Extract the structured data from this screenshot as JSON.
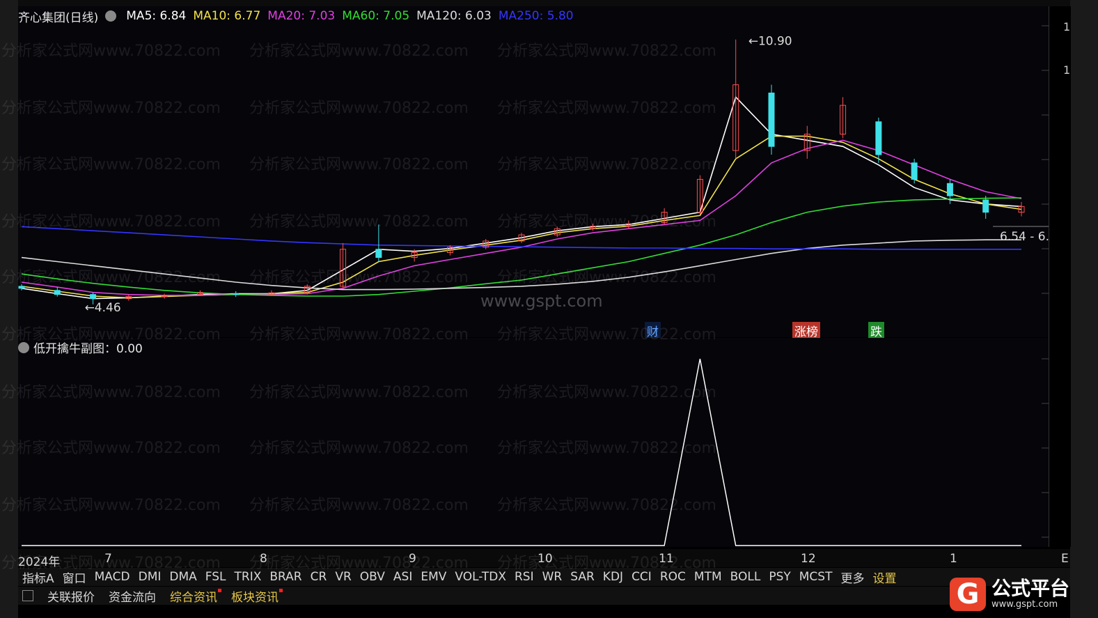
{
  "title": "齐心集团(日线)",
  "ma": [
    {
      "label": "MA5: 6.84",
      "color": "#ffffff"
    },
    {
      "label": "MA10: 6.77",
      "color": "#f2e24a"
    },
    {
      "label": "MA20: 7.03",
      "color": "#e040e0"
    },
    {
      "label": "MA60: 7.05",
      "color": "#33dd33"
    },
    {
      "label": "MA120: 6.03",
      "color": "#dddddd"
    },
    {
      "label": "MA250: 5.80",
      "color": "#3535ff"
    }
  ],
  "annotations": {
    "high": "10.90",
    "low": "4.46",
    "right": "6.54 - 6."
  },
  "tags": {
    "cai": "财",
    "zhangbang": "涨榜",
    "die": "跌"
  },
  "sub_title": "低开擒牛副图：0.00",
  "watermark_text": "分析家公式网www.70822.com",
  "site_text": "www.gspt.com",
  "x_labels": [
    "2024年",
    "7",
    "8",
    "9",
    "10",
    "11",
    "12",
    "1",
    "E"
  ],
  "y_labels": [
    "1",
    "1"
  ],
  "tabs": [
    "指标A",
    "窗口",
    "MACD",
    "DMI",
    "DMA",
    "FSL",
    "TRIX",
    "BRAR",
    "CR",
    "VR",
    "OBV",
    "ASI",
    "EMV",
    "VOL-TDX",
    "RSI",
    "WR",
    "SAR",
    "KDJ",
    "CCI",
    "ROC",
    "MTM",
    "BOLL",
    "PSY",
    "MCST",
    "更多",
    "设置"
  ],
  "bottom_items": [
    "关联报价",
    "资金流向",
    "综合资讯",
    "板块资讯"
  ],
  "logo": {
    "mark": "G",
    "name": "公式平台",
    "url": "www.gspt.com"
  },
  "chart_data": {
    "type": "candlestick",
    "title": "齐心集团(日线)",
    "ylim": [
      4.0,
      11.2
    ],
    "x_ticks": [
      "2024年",
      "7",
      "8",
      "9",
      "10",
      "11",
      "12",
      "1"
    ],
    "series": [
      {
        "name": "MA5",
        "color": "#ffffff",
        "values": [
          4.85,
          4.72,
          4.6,
          4.62,
          4.66,
          4.7,
          4.72,
          4.72,
          4.8,
          5.3,
          5.8,
          5.75,
          5.82,
          5.95,
          6.08,
          6.25,
          6.35,
          6.4,
          6.55,
          6.7,
          9.5,
          8.6,
          8.45,
          8.3,
          7.85,
          7.3,
          7.0,
          6.9,
          6.84
        ]
      },
      {
        "name": "MA10",
        "color": "#f2e24a",
        "values": [
          4.9,
          4.78,
          4.66,
          4.62,
          4.65,
          4.68,
          4.7,
          4.72,
          4.75,
          5.0,
          5.5,
          5.65,
          5.78,
          5.9,
          6.02,
          6.2,
          6.3,
          6.36,
          6.5,
          6.62,
          8.0,
          8.55,
          8.55,
          8.4,
          8.0,
          7.5,
          7.15,
          6.9,
          6.77
        ]
      },
      {
        "name": "MA20",
        "color": "#e040e0",
        "values": [
          5.0,
          4.88,
          4.75,
          4.7,
          4.68,
          4.68,
          4.7,
          4.7,
          4.72,
          4.85,
          5.15,
          5.4,
          5.55,
          5.7,
          5.85,
          6.05,
          6.2,
          6.3,
          6.4,
          6.5,
          7.1,
          7.9,
          8.25,
          8.45,
          8.2,
          7.85,
          7.5,
          7.2,
          7.03
        ]
      },
      {
        "name": "MA60",
        "color": "#33dd33",
        "values": [
          5.2,
          5.08,
          4.97,
          4.88,
          4.8,
          4.74,
          4.7,
          4.68,
          4.66,
          4.66,
          4.7,
          4.78,
          4.86,
          4.96,
          5.05,
          5.2,
          5.35,
          5.5,
          5.7,
          5.9,
          6.15,
          6.45,
          6.7,
          6.85,
          6.95,
          7.0,
          7.02,
          7.04,
          7.05
        ]
      },
      {
        "name": "MA120",
        "color": "#dddddd",
        "values": [
          5.6,
          5.5,
          5.4,
          5.3,
          5.2,
          5.1,
          5.0,
          4.92,
          4.86,
          4.82,
          4.82,
          4.83,
          4.85,
          4.87,
          4.9,
          4.95,
          5.02,
          5.12,
          5.25,
          5.4,
          5.55,
          5.7,
          5.82,
          5.9,
          5.95,
          6.0,
          6.02,
          6.03,
          6.03
        ]
      },
      {
        "name": "MA250",
        "color": "#3535ff",
        "values": [
          6.35,
          6.3,
          6.25,
          6.2,
          6.15,
          6.1,
          6.05,
          6.0,
          5.96,
          5.93,
          5.9,
          5.89,
          5.88,
          5.87,
          5.86,
          5.85,
          5.84,
          5.83,
          5.83,
          5.82,
          5.82,
          5.81,
          5.81,
          5.81,
          5.8,
          5.8,
          5.8,
          5.8,
          5.8
        ]
      }
    ],
    "candles": [
      {
        "o": 4.9,
        "c": 4.85,
        "h": 4.95,
        "l": 4.8
      },
      {
        "o": 4.8,
        "c": 4.7,
        "h": 4.88,
        "l": 4.65
      },
      {
        "o": 4.7,
        "c": 4.6,
        "h": 4.75,
        "l": 4.46
      },
      {
        "o": 4.6,
        "c": 4.65,
        "h": 4.7,
        "l": 4.55
      },
      {
        "o": 4.65,
        "c": 4.68,
        "h": 4.72,
        "l": 4.6
      },
      {
        "o": 4.7,
        "c": 4.75,
        "h": 4.8,
        "l": 4.66
      },
      {
        "o": 4.72,
        "c": 4.7,
        "h": 4.78,
        "l": 4.64
      },
      {
        "o": 4.7,
        "c": 4.74,
        "h": 4.8,
        "l": 4.66
      },
      {
        "o": 4.74,
        "c": 4.9,
        "h": 4.95,
        "l": 4.7
      },
      {
        "o": 4.9,
        "c": 5.8,
        "h": 5.95,
        "l": 4.85
      },
      {
        "o": 5.8,
        "c": 5.6,
        "h": 6.4,
        "l": 5.5
      },
      {
        "o": 5.6,
        "c": 5.72,
        "h": 5.8,
        "l": 5.5
      },
      {
        "o": 5.72,
        "c": 5.85,
        "h": 5.9,
        "l": 5.65
      },
      {
        "o": 5.85,
        "c": 6.0,
        "h": 6.05,
        "l": 5.8
      },
      {
        "o": 6.0,
        "c": 6.15,
        "h": 6.2,
        "l": 5.95
      },
      {
        "o": 6.15,
        "c": 6.3,
        "h": 6.35,
        "l": 6.1
      },
      {
        "o": 6.3,
        "c": 6.36,
        "h": 6.42,
        "l": 6.25
      },
      {
        "o": 6.36,
        "c": 6.42,
        "h": 6.5,
        "l": 6.3
      },
      {
        "o": 6.45,
        "c": 6.7,
        "h": 6.8,
        "l": 6.4
      },
      {
        "o": 6.7,
        "c": 7.5,
        "h": 7.6,
        "l": 6.65
      },
      {
        "o": 8.2,
        "c": 9.8,
        "h": 10.9,
        "l": 8.0
      },
      {
        "o": 9.6,
        "c": 8.3,
        "h": 9.8,
        "l": 8.1
      },
      {
        "o": 8.2,
        "c": 8.6,
        "h": 8.8,
        "l": 8.0
      },
      {
        "o": 8.6,
        "c": 9.3,
        "h": 9.5,
        "l": 8.5
      },
      {
        "o": 8.9,
        "c": 8.1,
        "h": 9.0,
        "l": 7.9
      },
      {
        "o": 7.9,
        "c": 7.5,
        "h": 8.0,
        "l": 7.4
      },
      {
        "o": 7.4,
        "c": 7.1,
        "h": 7.5,
        "l": 6.9
      },
      {
        "o": 7.0,
        "c": 6.7,
        "h": 7.1,
        "l": 6.54
      },
      {
        "o": 6.7,
        "c": 6.84,
        "h": 6.95,
        "l": 6.6
      }
    ],
    "sub_series": {
      "name": "低开擒牛副图",
      "value": 0.0,
      "spike_index": 19,
      "spike_value": 1
    }
  }
}
